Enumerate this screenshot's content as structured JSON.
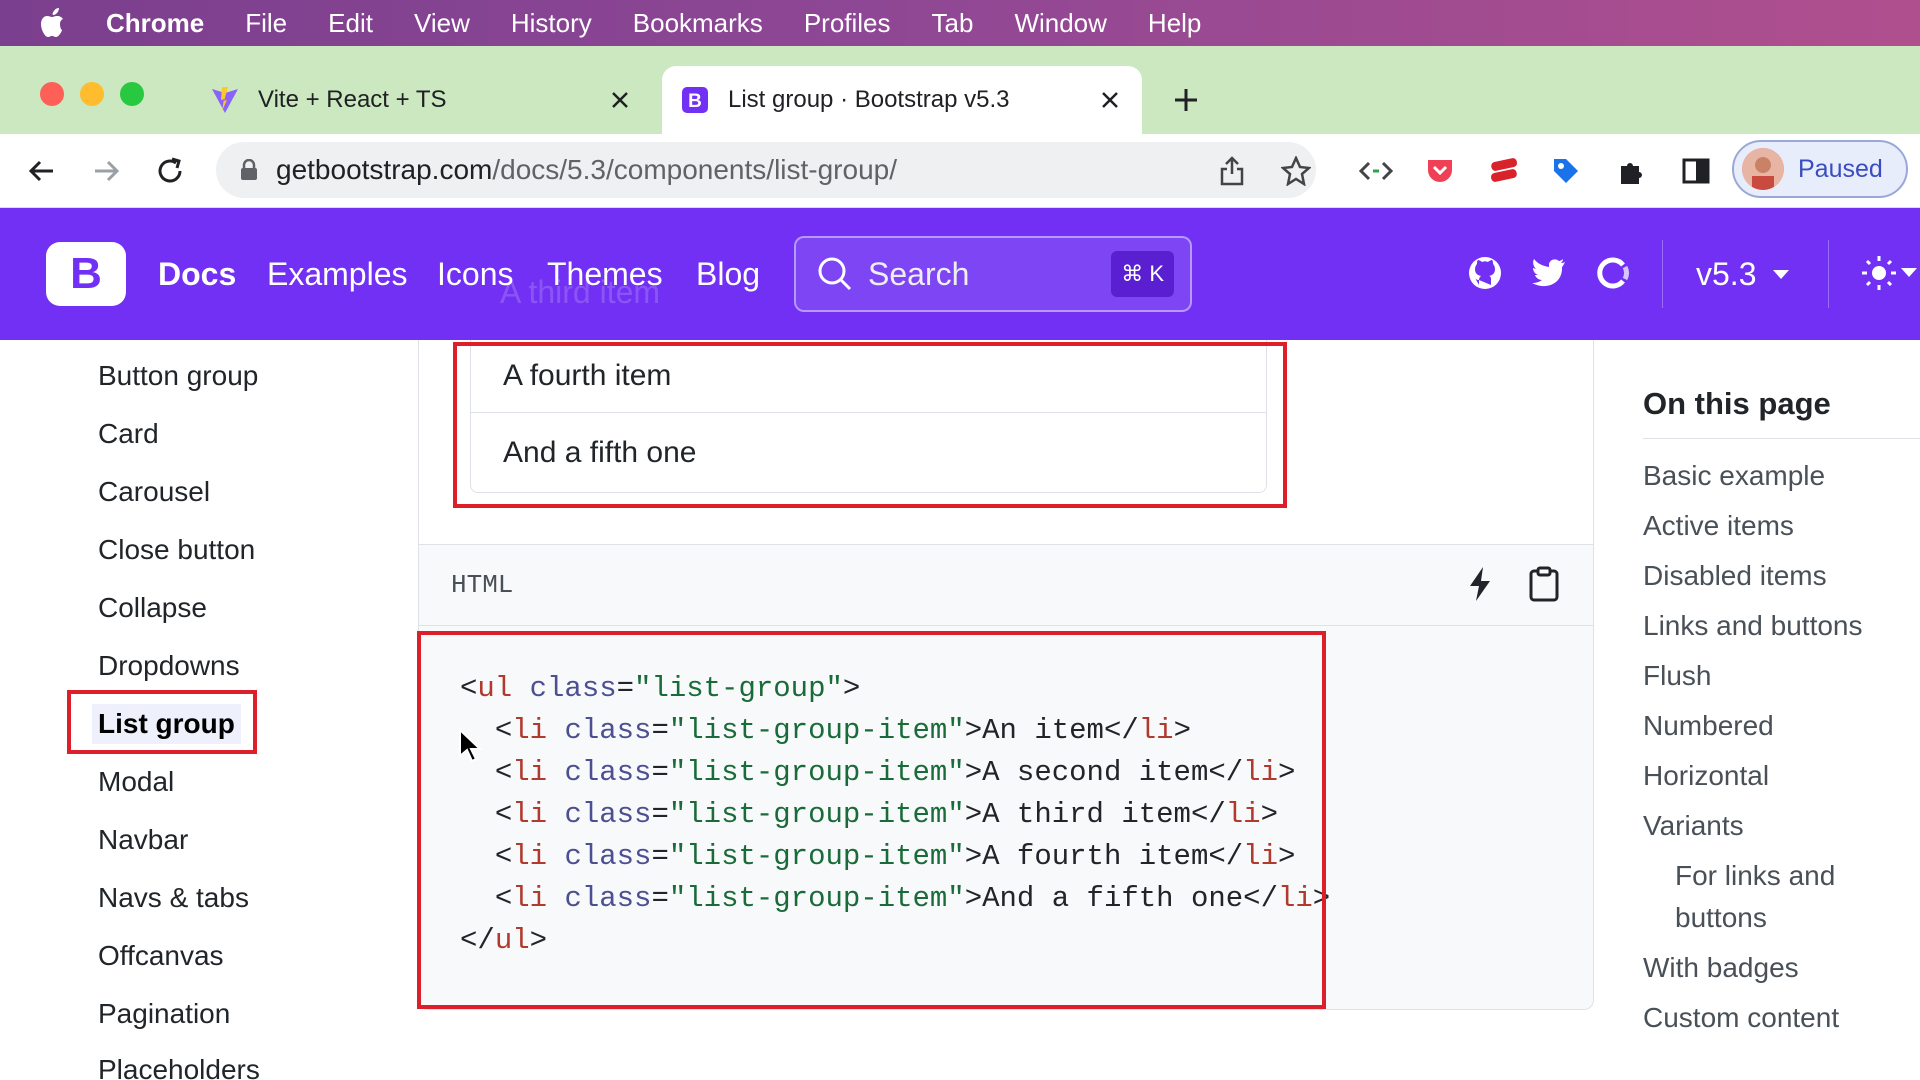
{
  "menubar": {
    "app": "Chrome",
    "items": [
      "File",
      "Edit",
      "View",
      "History",
      "Bookmarks",
      "Profiles",
      "Tab",
      "Window",
      "Help"
    ]
  },
  "tabs": {
    "inactive": {
      "title": "Vite + React + TS",
      "icon": "vite-icon"
    },
    "active": {
      "title": "List group · Bootstrap v5.3",
      "icon": "bootstrap-icon"
    }
  },
  "toolbar": {
    "url_host": "getbootstrap.com",
    "url_path": "/docs/5.3/components/list-group/",
    "profile_label": "Paused"
  },
  "navbar": {
    "logo": "B",
    "links": [
      "Docs",
      "Examples",
      "Icons",
      "Themes",
      "Blog"
    ],
    "ghost_text": "A third item",
    "search_placeholder": "Search",
    "search_kbd": "⌘ K",
    "version": "v5.3"
  },
  "sidebar": {
    "items": [
      "Button group",
      "Card",
      "Carousel",
      "Close button",
      "Collapse",
      "Dropdowns",
      "List group",
      "Modal",
      "Navbar",
      "Navs & tabs",
      "Offcanvas",
      "Pagination",
      "Placeholders"
    ],
    "active": "List group"
  },
  "preview": {
    "items": [
      "A fourth item",
      "And a fifth one"
    ]
  },
  "code": {
    "lang": "HTML",
    "lines": [
      "<ul class=\"list-group\">",
      "  <li class=\"list-group-item\">An item</li>",
      "  <li class=\"list-group-item\">A second item</li>",
      "  <li class=\"list-group-item\">A third item</li>",
      "  <li class=\"list-group-item\">A fourth item</li>",
      "  <li class=\"list-group-item\">And a fifth one</li>",
      "</ul>"
    ]
  },
  "toc": {
    "title": "On this page",
    "items": [
      "Basic example",
      "Active items",
      "Disabled items",
      "Links and buttons",
      "Flush",
      "Numbered",
      "Horizontal",
      "Variants",
      "For links and",
      "buttons",
      "With badges",
      "Custom content"
    ]
  },
  "colors": {
    "bootstrap_purple": "#7230f5",
    "highlight_red": "#dc1f2a",
    "tab_strip": "#cbe8c0"
  }
}
